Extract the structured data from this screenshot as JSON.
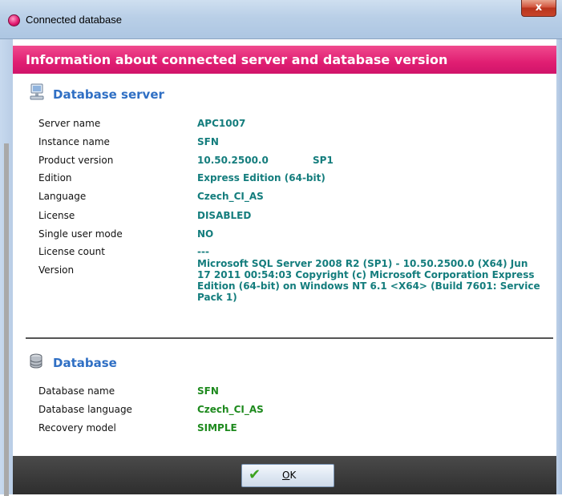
{
  "window": {
    "title": "Connected database",
    "close_label": "x"
  },
  "header": {
    "text": "Information about connected server and database version"
  },
  "server_section": {
    "title": "Database server",
    "rows": [
      {
        "label": "Server name",
        "value": "APC1007"
      },
      {
        "label": "Instance name",
        "value": "SFN"
      },
      {
        "label": "Product version",
        "value": "10.50.2500.0",
        "extra": "SP1"
      },
      {
        "label": "Edition",
        "value": "Express Edition (64-bit)"
      },
      {
        "label": "Language",
        "value": "Czech_CI_AS"
      },
      {
        "label": "License",
        "value": "DISABLED"
      },
      {
        "label": "Single user mode",
        "value": "NO"
      },
      {
        "label": "License count",
        "value": "---"
      },
      {
        "label": "Version",
        "value": "Microsoft SQL Server 2008 R2 (SP1) - 10.50.2500.0 (X64)  Jun 17 2011 00:54:03  Copyright (c) Microsoft Corporation Express Edition (64-bit) on Windows NT 6.1 <X64> (Build 7601: Service Pack 1)"
      }
    ]
  },
  "database_section": {
    "title": "Database",
    "rows": [
      {
        "label": "Database name",
        "value": "SFN"
      },
      {
        "label": "Database language",
        "value": "Czech_CI_AS"
      },
      {
        "label": "Recovery model",
        "value": "SIMPLE"
      }
    ]
  },
  "footer": {
    "ok_label_underlined": "O",
    "ok_label_rest": "K"
  },
  "icons": {
    "app": "app-icon",
    "server": "server-icon",
    "database": "database-icon",
    "ok": "check-icon"
  }
}
